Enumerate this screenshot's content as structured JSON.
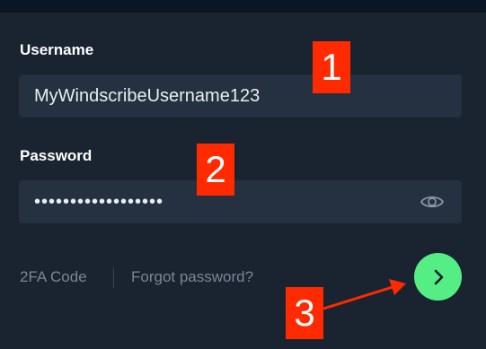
{
  "login_form": {
    "username_label": "Username",
    "username_value": "MyWindscribeUsername123",
    "password_label": "Password",
    "password_masked": "••••••••••••••••••",
    "twofa_link": "2FA Code",
    "forgot_link": "Forgot password?"
  },
  "annotations": {
    "marker_1": "1",
    "marker_2": "2",
    "marker_3": "3"
  },
  "colors": {
    "background": "#1a2431",
    "field": "#253140",
    "accent": "#55ee85",
    "marker": "#ff2a00"
  },
  "icons": {
    "password_toggle": "eye-icon",
    "submit": "chevron-right-icon"
  }
}
